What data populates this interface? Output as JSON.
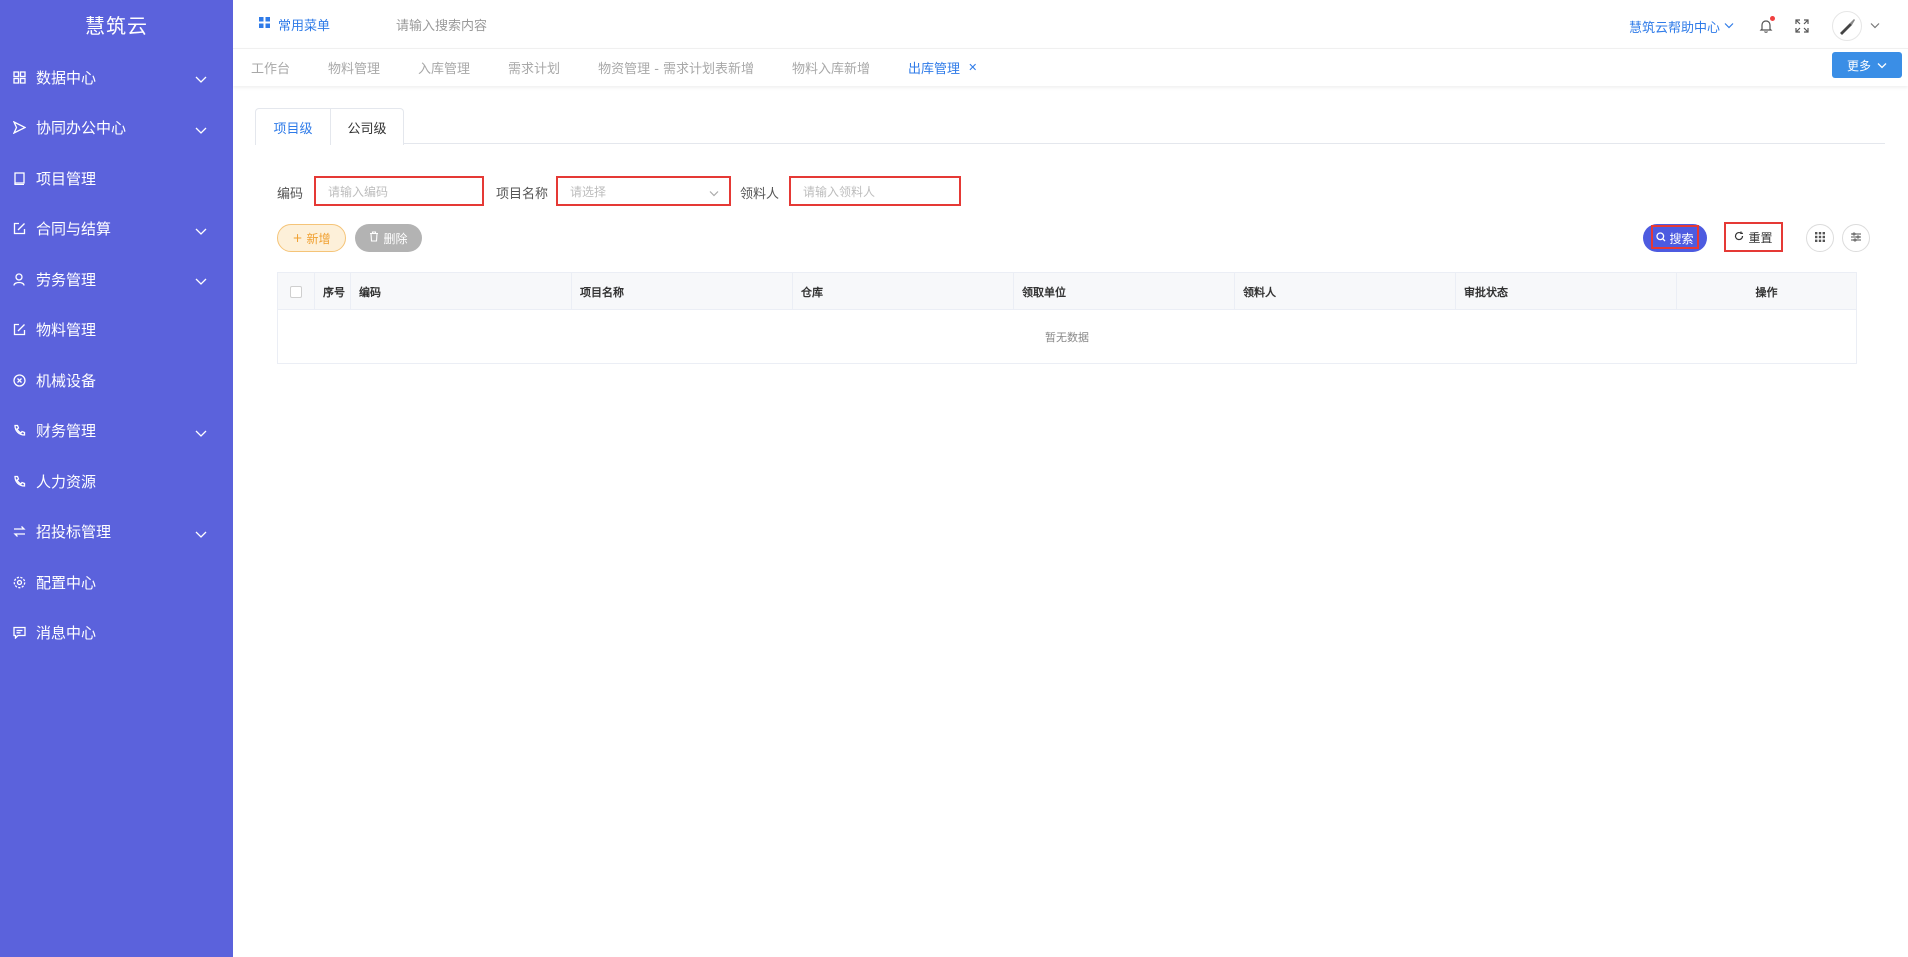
{
  "app": {
    "name": "慧筑云"
  },
  "sidebar": {
    "items": [
      {
        "label": "数据中心",
        "icon": "grid-icon",
        "expandable": true
      },
      {
        "label": "协同办公中心",
        "icon": "send-icon",
        "expandable": true
      },
      {
        "label": "项目管理",
        "icon": "book-icon",
        "expandable": false
      },
      {
        "label": "合同与结算",
        "icon": "edit-icon",
        "expandable": true
      },
      {
        "label": "劳务管理",
        "icon": "worker-icon",
        "expandable": true
      },
      {
        "label": "物料管理",
        "icon": "edit-icon",
        "expandable": false
      },
      {
        "label": "机械设备",
        "icon": "circle-x-icon",
        "expandable": false
      },
      {
        "label": "财务管理",
        "icon": "phone-icon",
        "expandable": true
      },
      {
        "label": "人力资源",
        "icon": "phone-icon",
        "expandable": false
      },
      {
        "label": "招投标管理",
        "icon": "swap-icon",
        "expandable": true
      },
      {
        "label": "配置中心",
        "icon": "gear-icon",
        "expandable": false
      },
      {
        "label": "消息中心",
        "icon": "message-icon",
        "expandable": false
      }
    ]
  },
  "topbar": {
    "common_menu": "常用菜单",
    "search_placeholder": "请输入搜索内容",
    "help": "慧筑云帮助中心"
  },
  "tabs": {
    "items": [
      "工作台",
      "物料管理",
      "入库管理",
      "需求计划",
      "物资管理 - 需求计划表新增",
      "物料入库新增",
      "出库管理"
    ],
    "active_index": 6,
    "more": "更多"
  },
  "page_tabs": [
    "项目级",
    "公司级"
  ],
  "filters": {
    "code_label": "编码",
    "code_placeholder": "请输入编码",
    "project_label": "项目名称",
    "project_placeholder": "请选择",
    "receiver_label": "领料人",
    "receiver_placeholder": "请输入领料人"
  },
  "actions": {
    "add": "新增",
    "delete": "删除",
    "search": "搜索",
    "reset": "重置"
  },
  "table": {
    "columns": [
      "序号",
      "编码",
      "项目名称",
      "仓库",
      "领取单位",
      "领料人",
      "审批状态",
      "操作"
    ],
    "empty_text": "暂无数据"
  },
  "colors": {
    "sidebar_bg": "#5b62dc",
    "accent": "#2f7be8",
    "highlight_border": "#e53935"
  }
}
